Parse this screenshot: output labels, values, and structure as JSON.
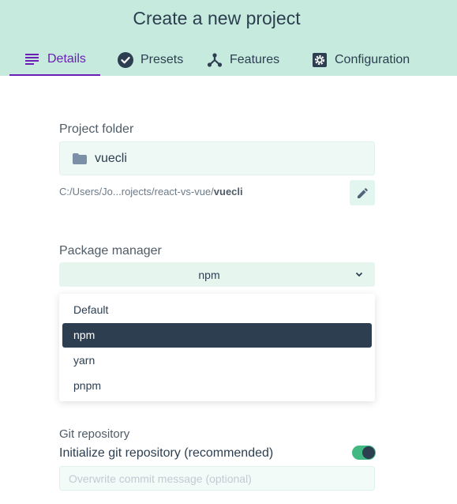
{
  "header": {
    "title": "Create a new project",
    "tabs": [
      {
        "label": "Details",
        "icon": "list-icon",
        "active": true
      },
      {
        "label": "Presets",
        "icon": "check-circle-icon",
        "active": false
      },
      {
        "label": "Features",
        "icon": "fork-icon",
        "active": false
      },
      {
        "label": "Configuration",
        "icon": "gear-icon",
        "active": false
      }
    ]
  },
  "project_folder": {
    "label": "Project folder",
    "value": "vuecli",
    "path_prefix": "C:/Users/Jo...rojects/react-vs-vue/",
    "path_bold": "vuecli"
  },
  "package_manager": {
    "label": "Package manager",
    "selected": "npm",
    "options": [
      "Default",
      "npm",
      "yarn",
      "pnpm"
    ]
  },
  "git": {
    "title": "Git repository",
    "init_label": "Initialize git repository (recommended)",
    "init_enabled": true,
    "commit_placeholder": "Overwrite commit message (optional)"
  },
  "colors": {
    "header_bg": "#c6eadd",
    "accent": "#6a1fb5",
    "toggle_on": "#42b983",
    "selected_bg": "#2c3e50"
  }
}
